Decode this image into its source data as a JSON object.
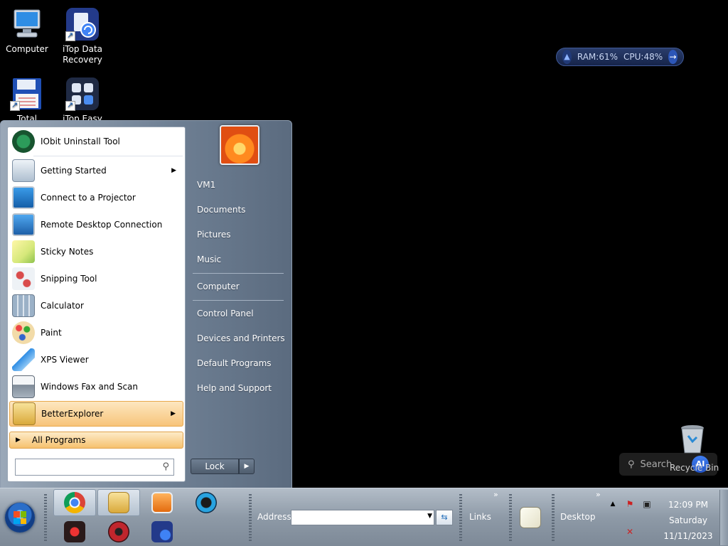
{
  "desktop": {
    "icons": [
      {
        "label": "Computer"
      },
      {
        "label": "iTop Data Recovery"
      },
      {
        "label": "Total"
      },
      {
        "label": "iTop Easy"
      }
    ],
    "recycle_bin_label": "Recycle Bin",
    "search_widget": {
      "placeholder": "Search",
      "ai_badge": "AI"
    }
  },
  "gadget": {
    "ram": "RAM:61%",
    "cpu": "CPU:48%"
  },
  "start_menu": {
    "pinned": [
      {
        "label": "IObit Uninstall Tool"
      }
    ],
    "recent": [
      {
        "label": "Getting Started",
        "has_submenu": true
      },
      {
        "label": "Connect to a Projector"
      },
      {
        "label": "Remote Desktop Connection"
      },
      {
        "label": "Sticky Notes"
      },
      {
        "label": "Snipping Tool"
      },
      {
        "label": "Calculator"
      },
      {
        "label": "Paint"
      },
      {
        "label": "XPS Viewer"
      },
      {
        "label": "Windows Fax and Scan"
      },
      {
        "label": "BetterExplorer",
        "has_submenu": true,
        "highlighted": true
      }
    ],
    "all_programs_label": "All Programs",
    "search": {
      "value": "",
      "placeholder": ""
    },
    "right_items": [
      {
        "label": "VM1"
      },
      {
        "label": "Documents"
      },
      {
        "label": "Pictures"
      },
      {
        "label": "Music"
      },
      {
        "label": "Computer"
      },
      {
        "label": "Control Panel"
      },
      {
        "label": "Devices and Printers"
      },
      {
        "label": "Default Programs"
      },
      {
        "label": "Help and Support"
      }
    ],
    "lock_label": "Lock"
  },
  "taskbar": {
    "address_label": "Address",
    "address_value": "",
    "links_label": "Links",
    "desktop_label": "Desktop",
    "clock": {
      "time": "12:09 PM",
      "day": "Saturday",
      "date": "11/11/2023"
    }
  },
  "colors": {
    "taskbar": "#8e9aa7",
    "start_highlight": "#f7c47a",
    "desktop": "#000000"
  }
}
